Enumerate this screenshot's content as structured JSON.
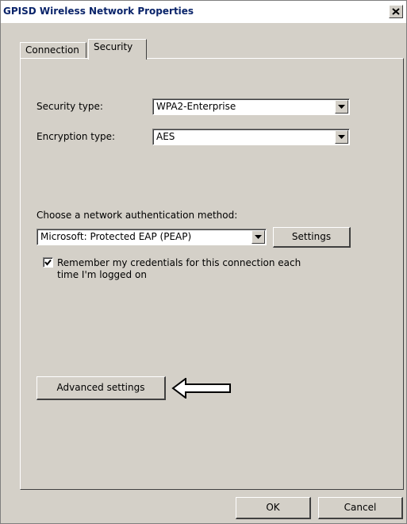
{
  "window": {
    "title": "GPISD Wireless Network Properties",
    "close_glyph": "✕"
  },
  "tabs": [
    {
      "label": "Connection",
      "selected": false
    },
    {
      "label": "Security",
      "selected": true
    }
  ],
  "security": {
    "security_type_label": "Security type:",
    "security_type_value": "WPA2-Enterprise",
    "encryption_type_label": "Encryption type:",
    "encryption_type_value": "AES",
    "auth_method_label": "Choose a network authentication method:",
    "auth_method_value": "Microsoft: Protected EAP (PEAP)",
    "settings_button": "Settings",
    "remember_line1": "Remember my credentials for this connection each",
    "remember_line2": "time I'm logged on",
    "remember_checked": true,
    "advanced_button": "Advanced settings"
  },
  "footer": {
    "ok_button": "OK",
    "cancel_button": "Cancel"
  },
  "icons": {
    "dropdown": "chevron-down-icon",
    "checkmark": "checkmark-icon",
    "annotation_arrow": "arrow-left-icon"
  }
}
